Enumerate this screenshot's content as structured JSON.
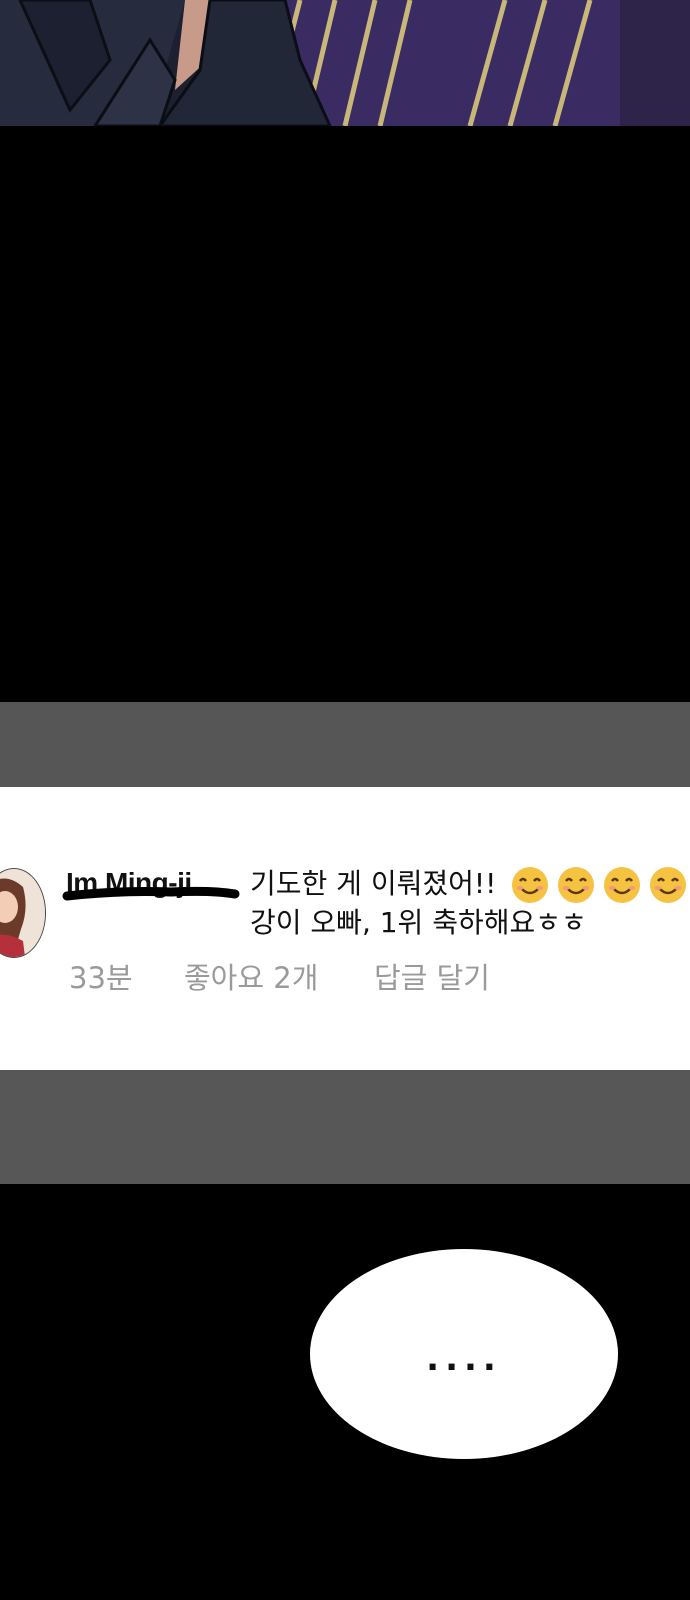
{
  "comment": {
    "username": "Im Ming-ji",
    "text_line1": "기도한 게 이뤄졌어!!",
    "text_line2": "강이 오빠, 1위 축하해요ㅎㅎ",
    "emoji_name": "smiling-face-icon",
    "emoji_count": 4,
    "time_ago": "33분",
    "likes": "좋아요 2개",
    "reply": "답글 달기"
  },
  "speech_bubble": {
    "text": "...."
  },
  "colors": {
    "gray_band": "#565656",
    "meta_text": "#9a9a9a",
    "emoji_face": "#f5c242"
  }
}
